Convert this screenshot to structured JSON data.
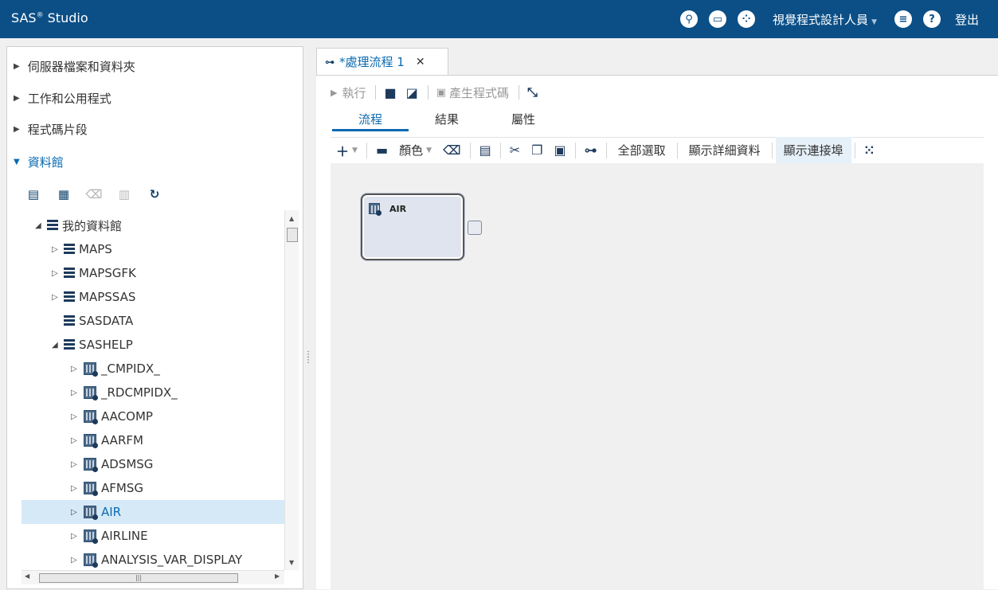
{
  "header": {
    "app_title": "SAS",
    "app_title_sup": "®",
    "app_title_rest": " Studio",
    "perspective": "視覺程式設計人員",
    "signout": "登出",
    "icons": [
      "search-icon",
      "open-folder-icon",
      "applications-icon",
      "menu-icon",
      "help-icon"
    ]
  },
  "left": {
    "sections": [
      {
        "label": "伺服器檔案和資料夾",
        "open": false
      },
      {
        "label": "工作和公用程式",
        "open": false
      },
      {
        "label": "程式碼片段",
        "open": false
      },
      {
        "label": "資料館",
        "open": true
      }
    ],
    "tree": [
      {
        "label": "我的資料館",
        "exp": "◢",
        "icon": "db",
        "indent": 0
      },
      {
        "label": "MAPS",
        "exp": "▷",
        "icon": "db",
        "indent": 1
      },
      {
        "label": "MAPSGFK",
        "exp": "▷",
        "icon": "db",
        "indent": 1
      },
      {
        "label": "MAPSSAS",
        "exp": "▷",
        "icon": "db",
        "indent": 1
      },
      {
        "label": "SASDATA",
        "exp": "",
        "icon": "db",
        "indent": 1
      },
      {
        "label": "SASHELP",
        "exp": "◢",
        "icon": "db",
        "indent": 1
      },
      {
        "label": "_CMPIDX_",
        "exp": "▷",
        "icon": "tbl",
        "indent": 2
      },
      {
        "label": "_RDCMPIDX_",
        "exp": "▷",
        "icon": "tbl",
        "indent": 2
      },
      {
        "label": "AACOMP",
        "exp": "▷",
        "icon": "tbl",
        "indent": 2
      },
      {
        "label": "AARFM",
        "exp": "▷",
        "icon": "tbl",
        "indent": 2
      },
      {
        "label": "ADSMSG",
        "exp": "▷",
        "icon": "tbl",
        "indent": 2
      },
      {
        "label": "AFMSG",
        "exp": "▷",
        "icon": "tbl",
        "indent": 2
      },
      {
        "label": "AIR",
        "exp": "▷",
        "icon": "tbl",
        "indent": 2,
        "selected": true
      },
      {
        "label": "AIRLINE",
        "exp": "▷",
        "icon": "tbl",
        "indent": 2
      },
      {
        "label": "ANALYSIS_VAR_DISPLAY",
        "exp": "▷",
        "icon": "tbl",
        "indent": 2
      }
    ]
  },
  "main": {
    "doc_tab": "*處理流程 1",
    "toolbar": {
      "run": "執行",
      "generate": "產生程式碼"
    },
    "subtabs": [
      "流程",
      "結果",
      "屬性"
    ],
    "flow_toolbar": {
      "color": "顏色",
      "select_all": "全部選取",
      "show_details": "顯示詳細資料",
      "show_ports": "顯示連接埠"
    },
    "node": {
      "label": "AIR"
    }
  },
  "colors": {
    "header_bg": "#0b4f86",
    "accent": "#0b6ab1",
    "selected_row": "#d6e9f7"
  }
}
